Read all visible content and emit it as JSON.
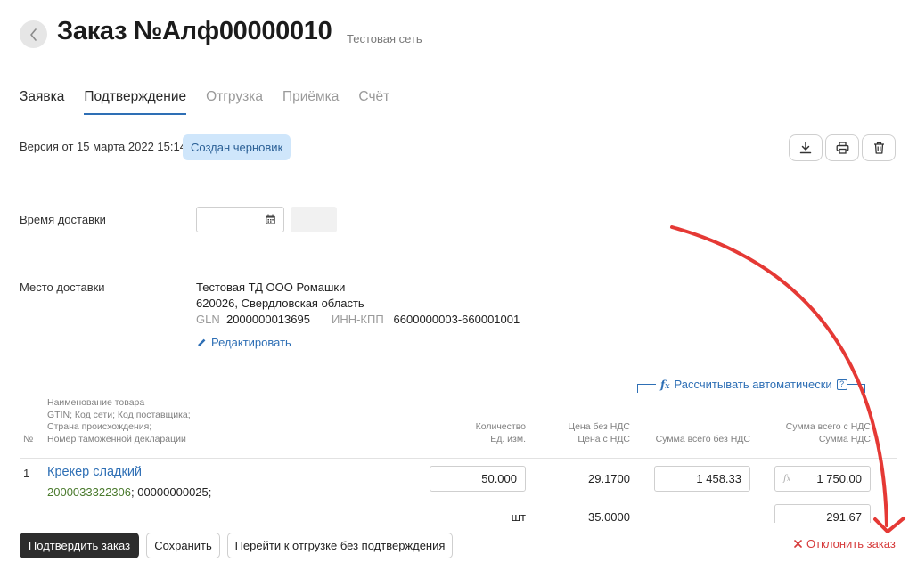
{
  "header": {
    "title": "Заказ №Алф00000010",
    "subtitle": "Тестовая сеть"
  },
  "tabs": [
    {
      "label": "Заявка"
    },
    {
      "label": "Подтверждение"
    },
    {
      "label": "Отгрузка"
    },
    {
      "label": "Приёмка"
    },
    {
      "label": "Счёт"
    }
  ],
  "version": {
    "text": "Версия от 15 марта 2022 15:14",
    "status": "Создан черновик"
  },
  "delivery_time": {
    "label": "Время доставки",
    "date_value": "",
    "time_value": ""
  },
  "delivery_place": {
    "label": "Место доставки",
    "name": "Тестовая ТД ООО Ромашки",
    "address": "620026, Свердловская область",
    "gln_label": "GLN",
    "gln_value": "2000000013695",
    "inn_label": "ИНН-КПП",
    "inn_value": "6600000003-660001001",
    "edit_label": "Редактировать"
  },
  "auto_calc": {
    "label": "Рассчитывать автоматически",
    "help": "?"
  },
  "table": {
    "headers": {
      "num": "№",
      "name_lines": [
        "Наименование товара",
        "GTIN; Код сети; Код поставщика;",
        "Страна происхождения;",
        "Номер таможенной декларации"
      ],
      "qty_lines": [
        "Количество",
        "Ед. изм."
      ],
      "price_lines": [
        "Цена без НДС",
        "Цена с НДС"
      ],
      "sum_no_vat": "Сумма всего без НДС",
      "sum_vat_lines": [
        "Сумма всего с НДС",
        "Сумма НДС"
      ]
    },
    "rows": [
      {
        "num": "1",
        "name": "Крекер сладкий",
        "gtin": "2000033322306",
        "codes_rest": "; 00000000025;",
        "quantity": "50.000",
        "unit": "шт",
        "price_no_vat": "29.1700",
        "price_vat": "35.0000",
        "sum_no_vat": "1 458.33",
        "sum_vat": "1 750.00",
        "vat_amount": "291.67"
      }
    ]
  },
  "footer": {
    "confirm": "Подтвердить заказ",
    "save": "Сохранить",
    "skip": "Перейти к отгрузке без подтверждения",
    "reject": "Отклонить заказ"
  },
  "colors": {
    "accent": "#2e6fb5",
    "badge_bg": "#cfe6fb",
    "danger": "#d63a3a",
    "gtin": "#4a7a2d",
    "annotation_arrow": "#e53935"
  }
}
